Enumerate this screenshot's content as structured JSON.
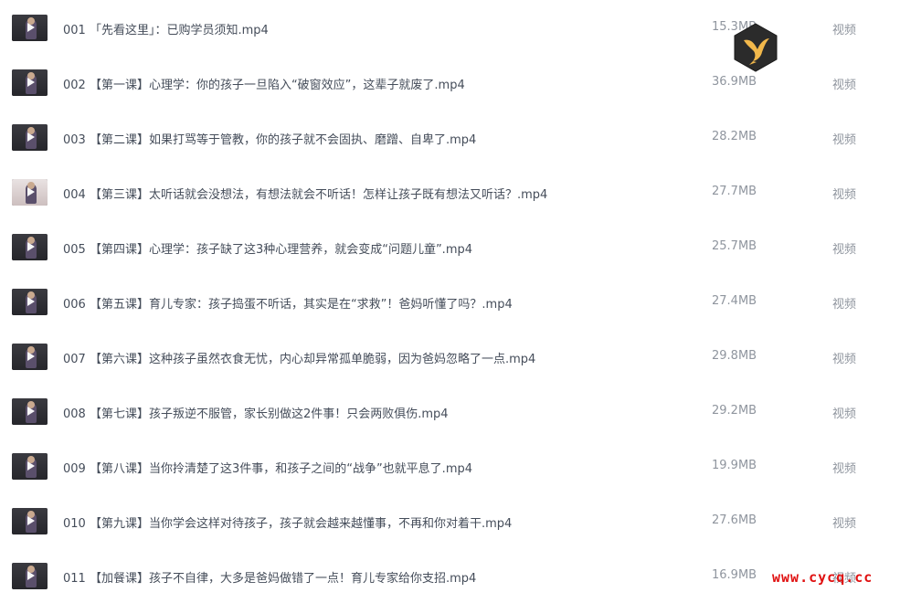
{
  "files": [
    {
      "name": "001 「先看这里」：已购学员须知.mp4",
      "size": "15.3MB",
      "type": "视频",
      "thumb": "dark"
    },
    {
      "name": "002 【第一课】心理学：你的孩子一旦陷入“破窗效应”，这辈子就废了.mp4",
      "size": "36.9MB",
      "type": "视频",
      "thumb": "dark"
    },
    {
      "name": "003 【第二课】如果打骂等于管教，你的孩子就不会固执、磨蹭、自卑了.mp4",
      "size": "28.2MB",
      "type": "视频",
      "thumb": "dark"
    },
    {
      "name": "004 【第三课】太听话就会没想法，有想法就会不听话！怎样让孩子既有想法又听话？.mp4",
      "size": "27.7MB",
      "type": "视频",
      "thumb": "light"
    },
    {
      "name": "005 【第四课】心理学：孩子缺了这3种心理营养，就会变成“问题儿童”.mp4",
      "size": "25.7MB",
      "type": "视频",
      "thumb": "dark"
    },
    {
      "name": "006 【第五课】育儿专家：孩子捣蛋不听话，其实是在“求救”！爸妈听懂了吗？.mp4",
      "size": "27.4MB",
      "type": "视频",
      "thumb": "dark"
    },
    {
      "name": "007 【第六课】这种孩子虽然衣食无忧，内心却异常孤单脆弱，因为爸妈忽略了一点.mp4",
      "size": "29.8MB",
      "type": "视频",
      "thumb": "dark"
    },
    {
      "name": "008 【第七课】孩子叛逆不服管，家长别做这2件事！只会两败俱伤.mp4",
      "size": "29.2MB",
      "type": "视频",
      "thumb": "dark"
    },
    {
      "name": "009 【第八课】当你拎清楚了这3件事，和孩子之间的“战争”也就平息了.mp4",
      "size": "19.9MB",
      "type": "视频",
      "thumb": "dark"
    },
    {
      "name": "010 【第九课】当你学会这样对待孩子，孩子就会越来越懂事，不再和你对着干.mp4",
      "size": "27.6MB",
      "type": "视频",
      "thumb": "dark"
    },
    {
      "name": "011 【加餐课】孩子不自律，大多是爸妈做错了一点！育儿专家给你支招.mp4",
      "size": "16.9MB",
      "type": "视频",
      "thumb": "dark"
    }
  ],
  "watermark": "www.cycq.cc",
  "colors": {
    "watermark": "#e01010",
    "logo_bg": "#2b2b2b",
    "logo_bird": "#f2b84b"
  },
  "logo_icon": "bird-logo-icon"
}
